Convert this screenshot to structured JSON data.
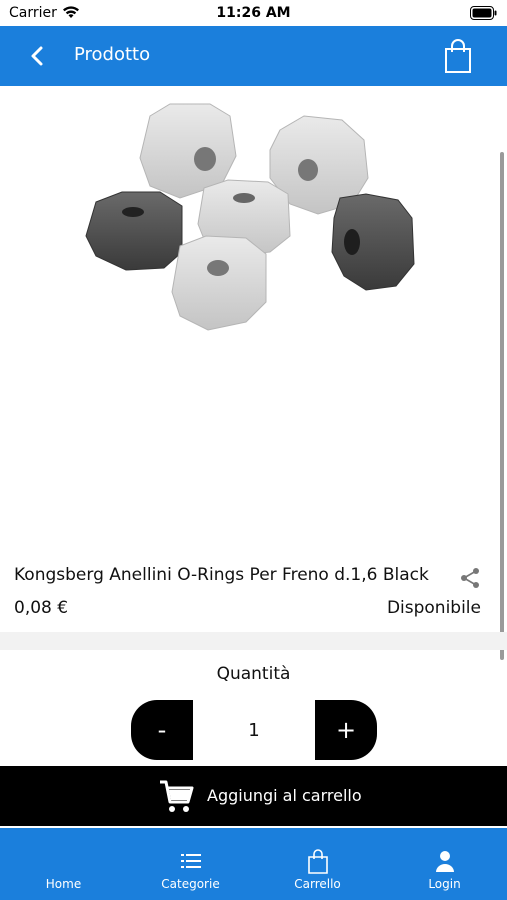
{
  "status_bar": {
    "carrier": "Carrier",
    "time": "11:26 AM"
  },
  "nav": {
    "title": "Prodotto",
    "back_icon": "chevron-left-icon",
    "cart_icon": "shopping-bag-icon"
  },
  "product": {
    "name": "Kongsberg Anellini O-Rings Per Freno d.1,6 Black",
    "price": "0,08 €",
    "availability": "Disponibile",
    "image": "octagonal-rings-image"
  },
  "quantity": {
    "label": "Quantità",
    "minus_label": "-",
    "value": "1",
    "plus_label": "+"
  },
  "add_to_cart": {
    "label": "Aggiungi al carrello",
    "icon": "cart-icon"
  },
  "tabs": [
    {
      "label": "Home",
      "icon": "home-icon"
    },
    {
      "label": "Categorie",
      "icon": "list-icon"
    },
    {
      "label": "Carrello",
      "icon": "shopping-bag-icon"
    },
    {
      "label": "Login",
      "icon": "user-icon"
    }
  ],
  "colors": {
    "primary": "#1b7fdc",
    "button": "#000000",
    "separator": "#f2f2f2"
  }
}
